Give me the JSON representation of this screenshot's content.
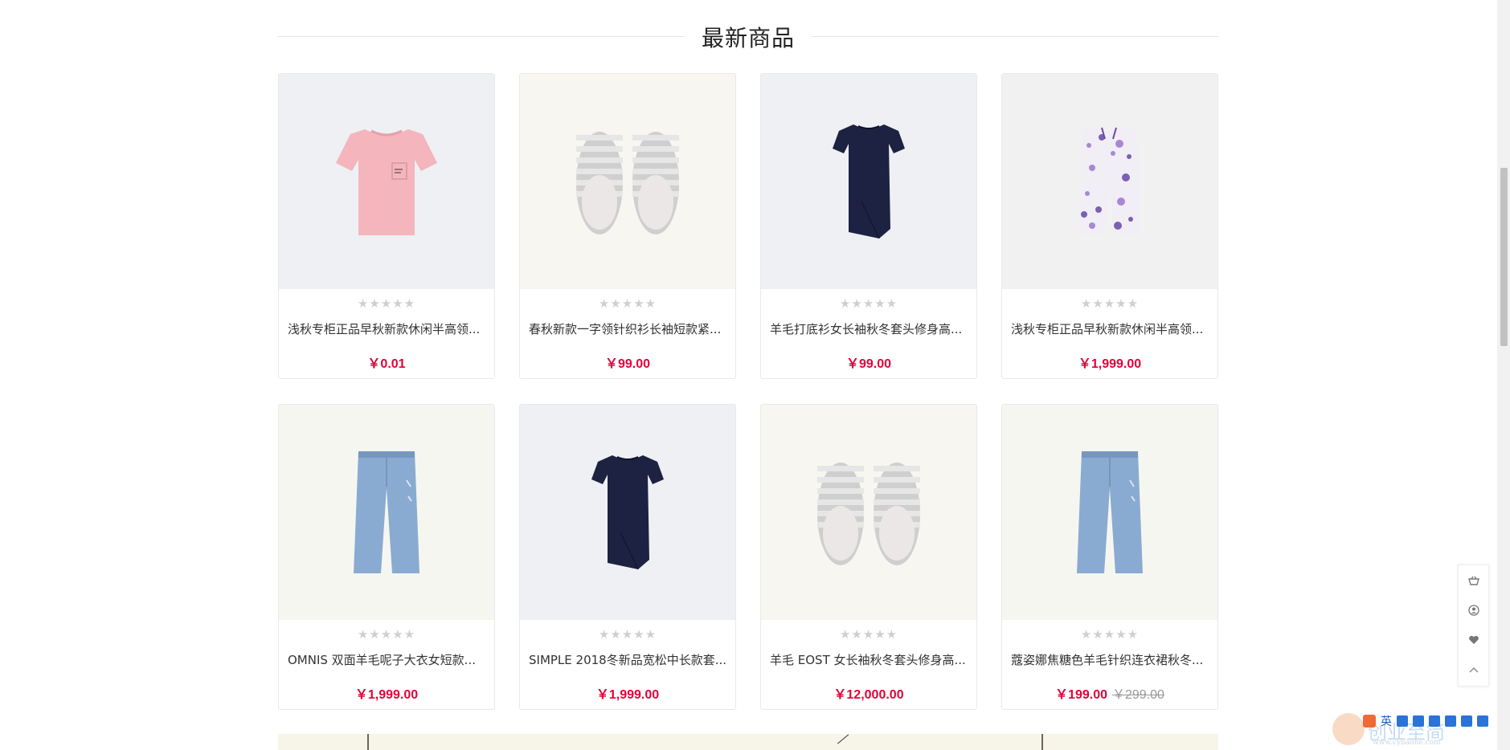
{
  "section": {
    "title": "最新商品"
  },
  "rating_stars": "★★★★★",
  "products": [
    {
      "name": "浅秋专柜正品早秋新款休闲半高领...",
      "price": "￥0.01",
      "old_price": "",
      "image": "pink-tshirt",
      "bg": "#eef0f3"
    },
    {
      "name": "春秋新款一字领针织衫长袖短款紧...",
      "price": "￥99.00",
      "old_price": "",
      "image": "striped-slippers",
      "bg": "#f7f6f1"
    },
    {
      "name": "羊毛打底衫女长袖秋冬套头修身高...",
      "price": "￥99.00",
      "old_price": "",
      "image": "navy-dress",
      "bg": "#eef0f3"
    },
    {
      "name": "浅秋专柜正品早秋新款休闲半高领...",
      "price": "￥1,999.00",
      "old_price": "",
      "image": "floral-pants",
      "bg": "#f1f1f1"
    },
    {
      "name": "OMNIS 双面羊毛呢子大衣女短款...",
      "price": "￥1,999.00",
      "old_price": "",
      "image": "wide-jeans",
      "bg": "#f6f6f1"
    },
    {
      "name": "SIMPLE 2018冬新品宽松中长款套...",
      "price": "￥1,999.00",
      "old_price": "",
      "image": "navy-dress",
      "bg": "#eef0f3"
    },
    {
      "name": "羊毛 EOST 女长袖秋冬套头修身高...",
      "price": "￥12,000.00",
      "old_price": "",
      "image": "striped-slippers",
      "bg": "#f7f6f1"
    },
    {
      "name": "蔻姿娜焦糖色羊毛针织连衣裙秋冬...",
      "price": "￥199.00",
      "old_price": "￥299.00",
      "image": "wide-jeans",
      "bg": "#f6f6f1"
    }
  ],
  "side_tools": [
    {
      "icon": "cart-icon"
    },
    {
      "icon": "user-icon"
    },
    {
      "icon": "heart-icon"
    },
    {
      "icon": "chevron-up-icon"
    }
  ],
  "ime": {
    "lang": "英"
  },
  "watermark": {
    "text": "创业至简",
    "url": "www.cybaohe.com"
  },
  "colors": {
    "price": "#e4003a",
    "star": "#cfcfcf",
    "border": "#e9e9e9"
  }
}
